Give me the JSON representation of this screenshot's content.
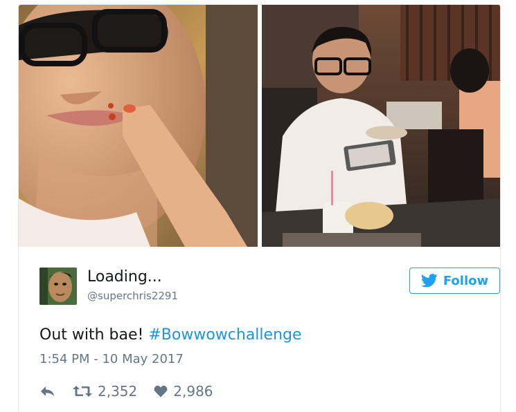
{
  "media": {
    "left_image": "photo-selfie-finger-on-lip",
    "right_image": "photo-man-at-restaurant-table"
  },
  "author": {
    "display_name": "Loading...",
    "handle": "@superchris2291",
    "avatar": "avatar-face"
  },
  "follow_button": {
    "label": "Follow",
    "icon": "twitter-bird-icon"
  },
  "tweet": {
    "text": "Out with bae!",
    "hashtag": "#Bowwowchallenge",
    "timestamp": "1:54 PM - 10 May 2017"
  },
  "actions": {
    "reply_icon": "reply-icon",
    "retweet_icon": "retweet-icon",
    "retweet_count": "2,352",
    "like_icon": "heart-icon",
    "like_count": "2,986"
  },
  "colors": {
    "twitter_blue": "#1da1f2",
    "hashtag": "#1b95e0",
    "secondary_text": "#657786",
    "primary_text": "#14171a",
    "border": "#e1e8ed"
  }
}
